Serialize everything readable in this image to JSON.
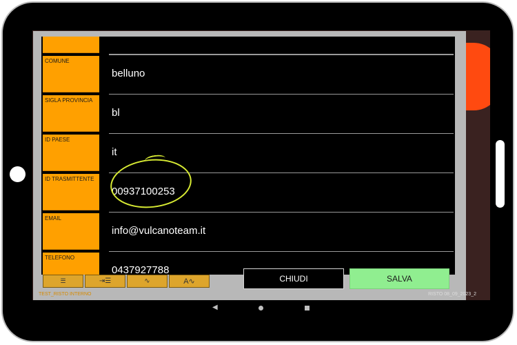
{
  "form": {
    "rows": [
      {
        "label": "",
        "value": ""
      },
      {
        "label": "COMUNE",
        "value": "belluno"
      },
      {
        "label": "SIGLA PROVINCIA",
        "value": "bl"
      },
      {
        "label": "ID PAESE",
        "value": "it"
      },
      {
        "label": "ID TRASMITTENTE",
        "value": "00937100253"
      },
      {
        "label": "EMAIL",
        "value": "info@vulcanoteam.it"
      },
      {
        "label": "TELEFONO",
        "value": "0437927788"
      }
    ]
  },
  "toolbar": {
    "icons": [
      "indent-decrease-icon",
      "indent-increase-icon",
      "signature-small-icon",
      "spellcheck-icon"
    ],
    "glyphs": [
      "☰",
      "⇥☰",
      "∿",
      "A∿"
    ]
  },
  "buttons": {
    "close_label": "CHIUDI",
    "save_label": "SALVA"
  },
  "footer": {
    "left_text": "TEST_RISTO INTERNO",
    "right_text": "RISTO 08_09_2023_2"
  },
  "colors": {
    "label_bg": "#ffa000",
    "save_bg": "#90ee90",
    "annotation": "#d7ea33",
    "accent": "#ff4a10"
  }
}
